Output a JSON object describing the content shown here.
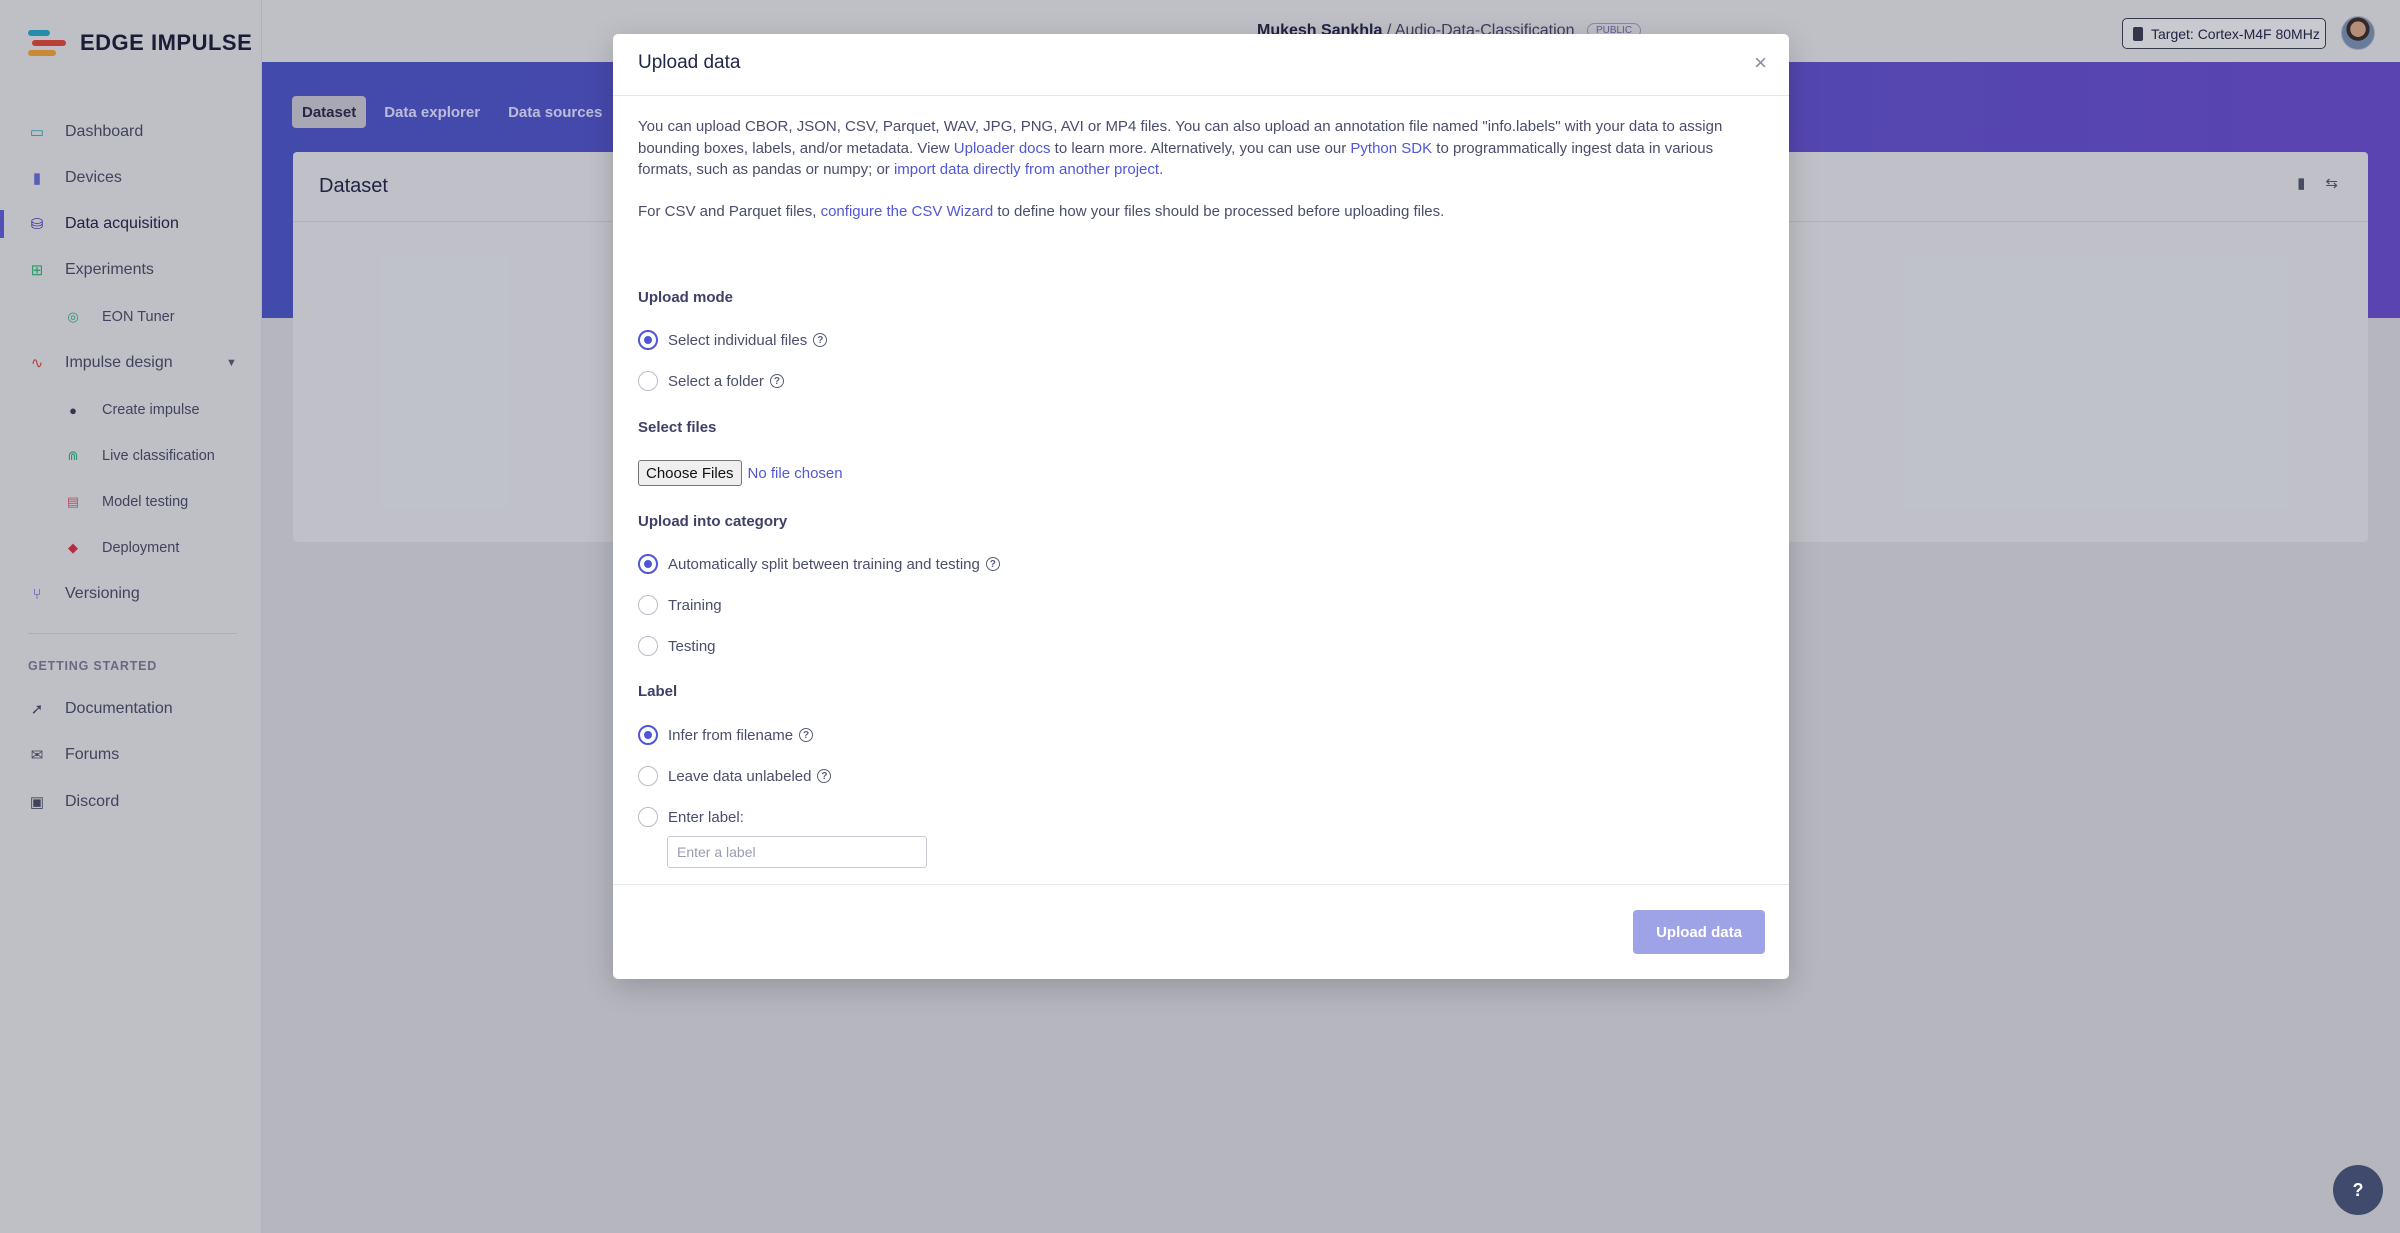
{
  "brand": {
    "name": "EDGE IMPULSE"
  },
  "sidebar": {
    "items": [
      {
        "label": "Dashboard",
        "icon": "monitor-icon",
        "color": "#2aa7c9"
      },
      {
        "label": "Devices",
        "icon": "chip-icon",
        "color": "#6a6dd6"
      },
      {
        "label": "Data acquisition",
        "icon": "database-icon",
        "color": "#4b34b8"
      },
      {
        "label": "Experiments",
        "icon": "table-icon",
        "color": "#2db37a"
      },
      {
        "label": "EON Tuner",
        "icon": "compass-icon",
        "color": "#2db37a"
      },
      {
        "label": "Impulse design",
        "icon": "pulse-icon",
        "color": "#e0483e"
      },
      {
        "label": "Create impulse",
        "icon": "dot-icon",
        "color": "#3c3f56"
      },
      {
        "label": "Live classification",
        "icon": "graph-icon",
        "color": "#2db37a"
      },
      {
        "label": "Model testing",
        "icon": "clipboard-icon",
        "color": "#e25d6c"
      },
      {
        "label": "Deployment",
        "icon": "cube-icon",
        "color": "#d9304c"
      },
      {
        "label": "Versioning",
        "icon": "branch-icon",
        "color": "#5157d6"
      }
    ],
    "getting_started_title": "GETTING STARTED",
    "getting_started": [
      {
        "label": "Documentation",
        "icon": "rocket-icon"
      },
      {
        "label": "Forums",
        "icon": "chat-icon"
      },
      {
        "label": "Discord",
        "icon": "discord-icon"
      }
    ]
  },
  "header": {
    "user": "Mukesh Sankhla",
    "separator": "/",
    "project": "Audio-Data-Classification",
    "visibility": "PUBLIC",
    "target": "Target: Cortex-M4F 80MHz"
  },
  "tabs": [
    "Dataset",
    "Data explorer",
    "Data sources"
  ],
  "card": {
    "title": "Dataset"
  },
  "modal": {
    "title": "Upload data",
    "close": "×",
    "intro": {
      "t1": "You can upload CBOR, JSON, CSV, Parquet, WAV, JPG, PNG, AVI or MP4 files. You can also upload an annotation file named \"info.labels\" with your data to assign bounding boxes, labels, and/or metadata. View ",
      "link1": "Uploader docs",
      "t2": " to learn more. Alternatively, you can use our ",
      "link2": "Python SDK",
      "t3": " to programmatically ingest data in various formats, such as pandas or numpy; or ",
      "link3": "import data directly from another project",
      "t4": "."
    },
    "csv": {
      "t1": "For CSV and Parquet files, ",
      "link": "configure the CSV Wizard",
      "t2": " to define how your files should be processed before uploading files."
    },
    "upload_mode": {
      "title": "Upload mode",
      "options": [
        "Select individual files",
        "Select a folder"
      ],
      "selected": 0
    },
    "select_files": {
      "title": "Select files",
      "button": "Choose Files",
      "status": "No file chosen"
    },
    "category": {
      "title": "Upload into category",
      "options": [
        "Automatically split between training and testing",
        "Training",
        "Testing"
      ],
      "selected": 0
    },
    "label": {
      "title": "Label",
      "options": [
        "Infer from filename",
        "Leave data unlabeled",
        "Enter label:"
      ],
      "selected": 0,
      "placeholder": "Enter a label"
    },
    "submit": "Upload data"
  },
  "help_fab": "?"
}
